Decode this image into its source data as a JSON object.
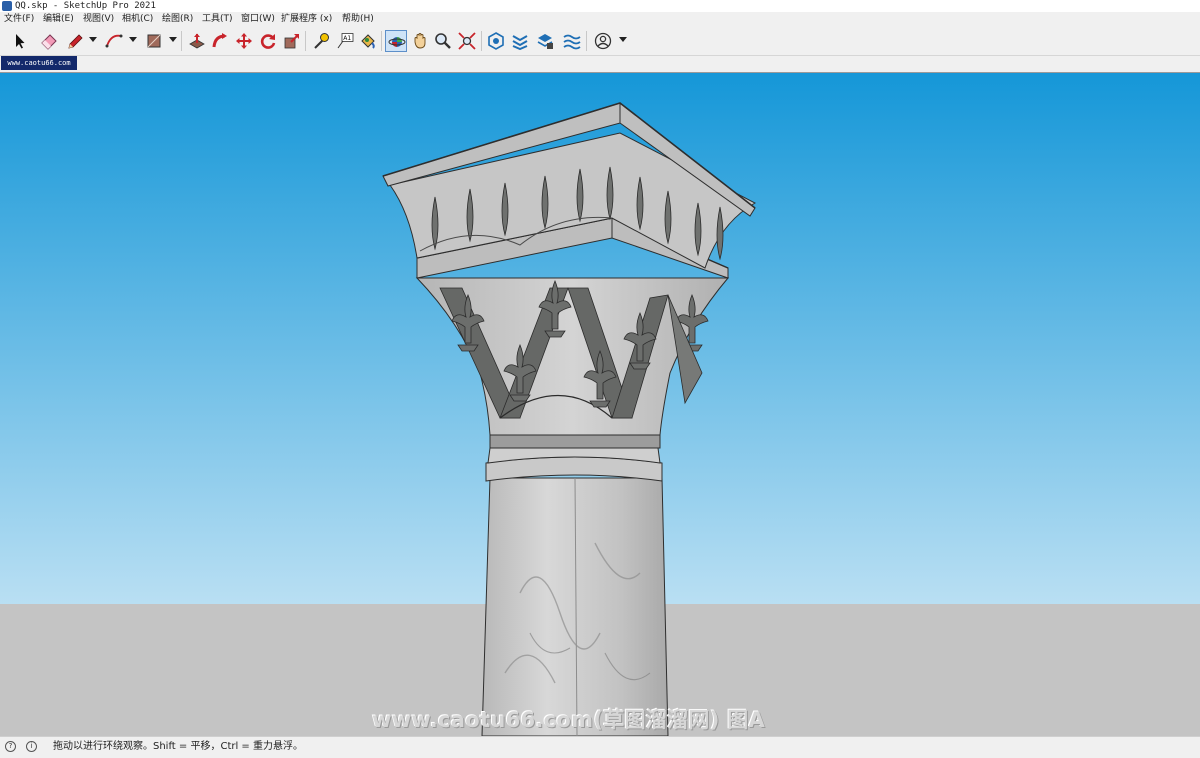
{
  "window": {
    "title": "QQ.skp - SketchUp Pro 2021"
  },
  "menu": [
    {
      "label": "文件(F)"
    },
    {
      "label": "编辑(E)"
    },
    {
      "label": "视图(V)"
    },
    {
      "label": "相机(C)"
    },
    {
      "label": "绘图(R)"
    },
    {
      "label": "工具(T)"
    },
    {
      "label": "窗口(W)"
    },
    {
      "label": "扩展程序 (x)"
    },
    {
      "label": "帮助(H)"
    }
  ],
  "toolbar": {
    "tools": [
      {
        "icon": "select-arrow-icon"
      },
      {
        "icon": "eraser-icon"
      },
      {
        "icon": "line-pencil-icon"
      },
      {
        "icon": "arc-icon"
      },
      {
        "icon": "rectangle-icon"
      },
      {
        "icon": "push-pull-icon"
      },
      {
        "icon": "follow-me-icon"
      },
      {
        "icon": "move-icon"
      },
      {
        "icon": "rotate-icon"
      },
      {
        "icon": "scale-icon"
      },
      {
        "icon": "tape-measure-icon"
      },
      {
        "icon": "text-label-icon"
      },
      {
        "icon": "paint-bucket-icon"
      },
      {
        "icon": "orbit-icon",
        "active": true
      },
      {
        "icon": "pan-hand-icon"
      },
      {
        "icon": "zoom-icon"
      },
      {
        "icon": "zoom-extents-icon"
      },
      {
        "icon": "warehouse-icon"
      },
      {
        "icon": "extension-warehouse-icon"
      },
      {
        "icon": "layout-icon"
      },
      {
        "icon": "sandbox-icon"
      },
      {
        "icon": "account-icon"
      }
    ],
    "text_label_glyph": "A1"
  },
  "scene_tab": {
    "label": "www.caotu66.com"
  },
  "viewport": {
    "sky_top": "#1597d8",
    "sky_bottom": "#b9dff3",
    "ground": "#c4c4c4"
  },
  "watermark": {
    "text": "www.caotu66.com(草图溜溜网) 图A"
  },
  "status": {
    "text": "拖动以进行环绕观察。Shift = 平移，Ctrl = 重力悬浮。"
  }
}
